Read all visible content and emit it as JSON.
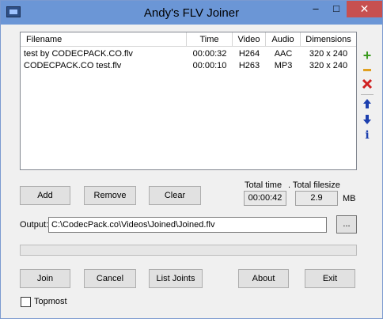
{
  "window": {
    "title": "Andy's FLV Joiner",
    "minimize_glyph": "–",
    "maximize_glyph": "□",
    "close_glyph": "✕"
  },
  "file_list": {
    "columns": {
      "filename": "Filename",
      "time": "Time",
      "video": "Video",
      "audio": "Audio",
      "dimensions": "Dimensions"
    },
    "rows": [
      {
        "filename": "test by CODECPACK.CO.flv",
        "time": "00:00:32",
        "video": "H264",
        "audio": "AAC",
        "dimensions": "320 x 240"
      },
      {
        "filename": "CODECPACK.CO test.flv",
        "time": "00:00:10",
        "video": "H263",
        "audio": "MP3",
        "dimensions": "320 x 240"
      }
    ]
  },
  "side_toolbar": {
    "add_icon": "plus-icon",
    "remove_icon": "minus-icon",
    "clear_icon": "close-x-icon",
    "up_icon": "arrow-up-icon",
    "down_icon": "arrow-down-icon",
    "info_icon": "info-icon",
    "colors": {
      "add": "#3a9a1e",
      "remove": "#e0a020",
      "clear": "#d02020",
      "arrows": "#1c3fae"
    }
  },
  "buttons": {
    "add": "Add",
    "remove": "Remove",
    "clear": "Clear",
    "join": "Join",
    "cancel": "Cancel",
    "list_joints": "List Joints",
    "about": "About",
    "exit": "Exit",
    "browse": "..."
  },
  "totals": {
    "time_label": "Total time",
    "time_value": "00:00:42",
    "size_label": ". Total filesize",
    "size_value": "2.9",
    "size_unit": "MB"
  },
  "output": {
    "label": "Output:",
    "path": "C:\\CodecPack.co\\Videos\\Joined\\Joined.flv"
  },
  "progress": {
    "value": 0
  },
  "options": {
    "topmost_label": "Topmost",
    "topmost_checked": false
  }
}
